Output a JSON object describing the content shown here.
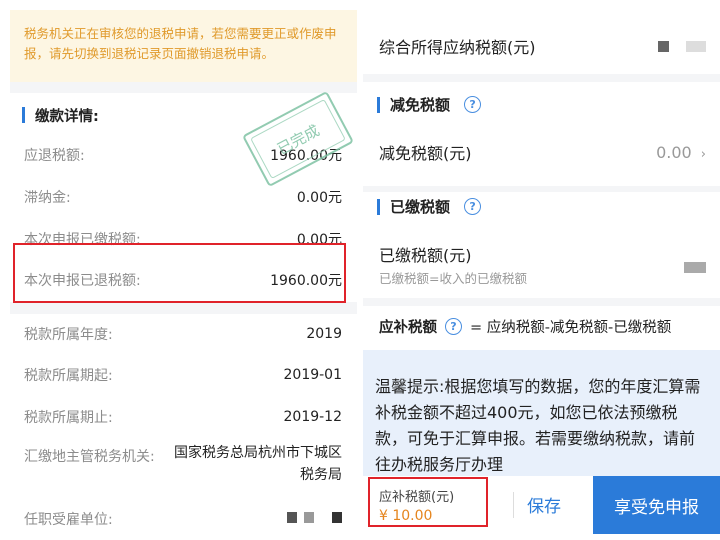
{
  "left": {
    "notice": "税务机关正在审核您的退税申请，若您需要更正或作废申报，请先切换到退税记录页面撤销退税申请。",
    "section_title": "缴款详情:",
    "stamp": "已完成",
    "rows": [
      {
        "label": "应退税额:",
        "value": "1960.00元"
      },
      {
        "label": "滞纳金:",
        "value": "0.00元"
      },
      {
        "label": "本次申报已缴税额:",
        "value": "0.00元"
      },
      {
        "label": "本次申报已退税额:",
        "value": "1960.00元"
      },
      {
        "label": "税款所属年度:",
        "value": "2019"
      },
      {
        "label": "税款所属期起:",
        "value": "2019-01"
      },
      {
        "label": "税款所属期止:",
        "value": "2019-12"
      },
      {
        "label": "汇缴地主管税务机关:",
        "value": "国家税务总局杭州市下城区税务局"
      },
      {
        "label": "任职受雇单位:",
        "value": ""
      }
    ]
  },
  "right": {
    "payable_label": "综合所得应纳税额(元)",
    "reduction_section": "减免税额",
    "reduction_label": "减免税额(元)",
    "reduction_value": "0.00",
    "paid_section": "已缴税额",
    "paid_label": "已缴税额(元)",
    "paid_sub": "已缴税额=收入的已缴税额",
    "formula_label": "应补税额",
    "formula": "= 应纳税额-减免税额-已缴税额",
    "tip": "温馨提示:根据您填写的数据，您的年度汇算需补税金额不超过400元，如您已依法预缴税款，可免于汇算申报。若需要缴纳税款，请前往办税服务厅办理",
    "due_label": "应补税额(元)",
    "due_value": "¥ 10.00",
    "save_button": "保存",
    "apply_button": "享受免申报"
  },
  "colors": {
    "accent": "#2b7bd9",
    "highlight_box": "#e0232a",
    "notice_text": "#e09a2b",
    "due_value": "#e5851e"
  },
  "icons": [
    "question-circle-icon",
    "chevron-right-icon",
    "completed-stamp"
  ]
}
